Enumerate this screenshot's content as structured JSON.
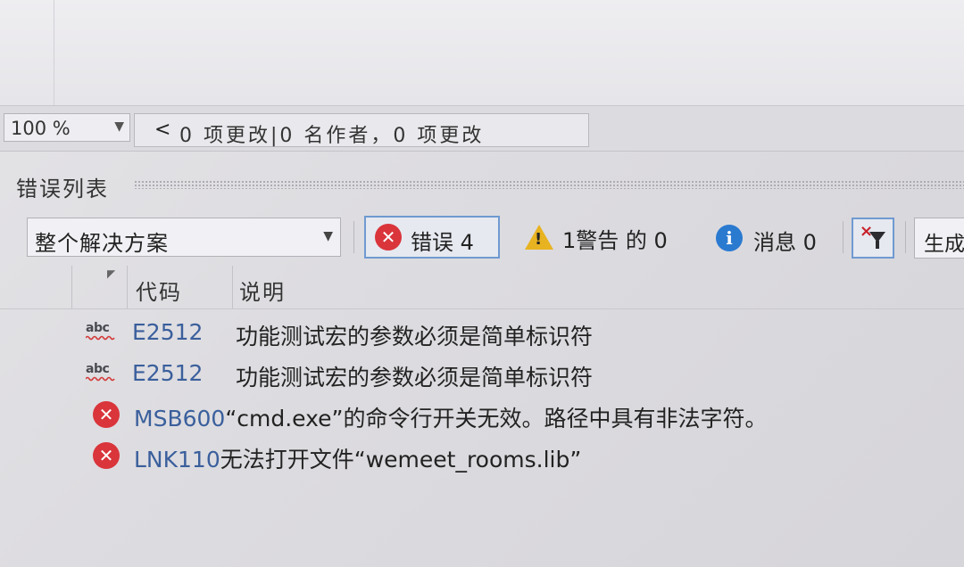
{
  "status_bar": {
    "zoom": "100 %",
    "changes_arrow": "<",
    "changes_text": "0 项更改|0 名作者，0 项更改"
  },
  "error_list": {
    "title": "错误列表",
    "toolbar": {
      "scope": "整个解决方案",
      "errors_label": "错误 4",
      "warnings_label": "1警告 的 0",
      "messages_label": "消息 0",
      "build_label": "生成"
    },
    "columns": {
      "code": "代码",
      "description": "说明"
    },
    "rows": [
      {
        "type": "spelling",
        "code": "E2512",
        "description": "功能测试宏的参数必须是简单标识符"
      },
      {
        "type": "spelling",
        "code": "E2512",
        "description": "功能测试宏的参数必须是简单标识符"
      },
      {
        "type": "error",
        "code": "MSB600",
        "description": "“cmd.exe”的命令行开关无效。路径中具有非法字符。"
      },
      {
        "type": "error",
        "code": "LNK110",
        "description": "无法打开文件“wemeet_rooms.lib”"
      }
    ]
  },
  "icons": {
    "spelling": "spell-check-icon",
    "error": "error-circle-icon",
    "warning": "warning-triangle-icon",
    "info": "info-circle-icon",
    "filter": "clear-filter-icon"
  },
  "colors": {
    "error": "#d9353b",
    "warning": "#e8b321",
    "info": "#2a7ad0",
    "code_link": "#3a5f9c",
    "selected_border": "#6f9ad1"
  }
}
